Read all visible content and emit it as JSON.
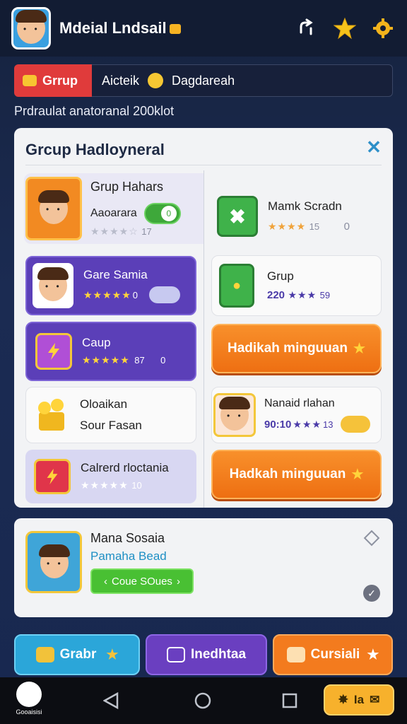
{
  "header": {
    "title": "Mdeial Lndsail",
    "icons": [
      "avatar",
      "share-icon",
      "star-icon",
      "gear-icon"
    ],
    "colors": {
      "star": "#f6c31b",
      "gear": "#f2b31c"
    }
  },
  "tabs": {
    "group_label": "Grrup",
    "search_left": "Aicteik",
    "search_right": "Dagdareah"
  },
  "subtitle": "Prdraulat anatoranal 200klot",
  "panel": {
    "title": "Grcup Hadloyneral",
    "left_cards": [
      {
        "title": "Grup Hahars",
        "sub": "Aaoarara",
        "stars": "★★★★☆",
        "count": "17",
        "toggle": "0"
      },
      {
        "title": "Gare Samia",
        "stars": "★★★★★",
        "count": "0"
      },
      {
        "title": "Caup",
        "stars": "★★★★★",
        "count": "87",
        "extra": "0"
      },
      {
        "title": "Oloaikan",
        "sub": "Sour Fasan"
      },
      {
        "title": "Calrerd rloctania",
        "stars": "★★★★★",
        "count": "10"
      }
    ],
    "right_cards": [
      {
        "title": "Mamk Scradn",
        "stars": "★★★★",
        "count": "15",
        "extra": "0"
      },
      {
        "title": "Grup",
        "prefix": "220",
        "stars": "★★★",
        "count": "59"
      },
      {
        "title": "Nanaid rlahan",
        "prefix": "90:10",
        "stars": "★★★",
        "count": "13"
      }
    ],
    "orange_button_1": "Hadikah minguuan",
    "orange_button_2": "Hadkah minguuan"
  },
  "panel2": {
    "title": "Mana Sosaia",
    "subtitle": "Pamaha Bead",
    "button": "Coue SOues"
  },
  "bottom_buttons": {
    "b1": "Grabr",
    "b2": "Inedhtaa",
    "b3": "Cursiali"
  },
  "navbar": {
    "logo_text": "Gooaisisi",
    "right_label": "Ia"
  }
}
